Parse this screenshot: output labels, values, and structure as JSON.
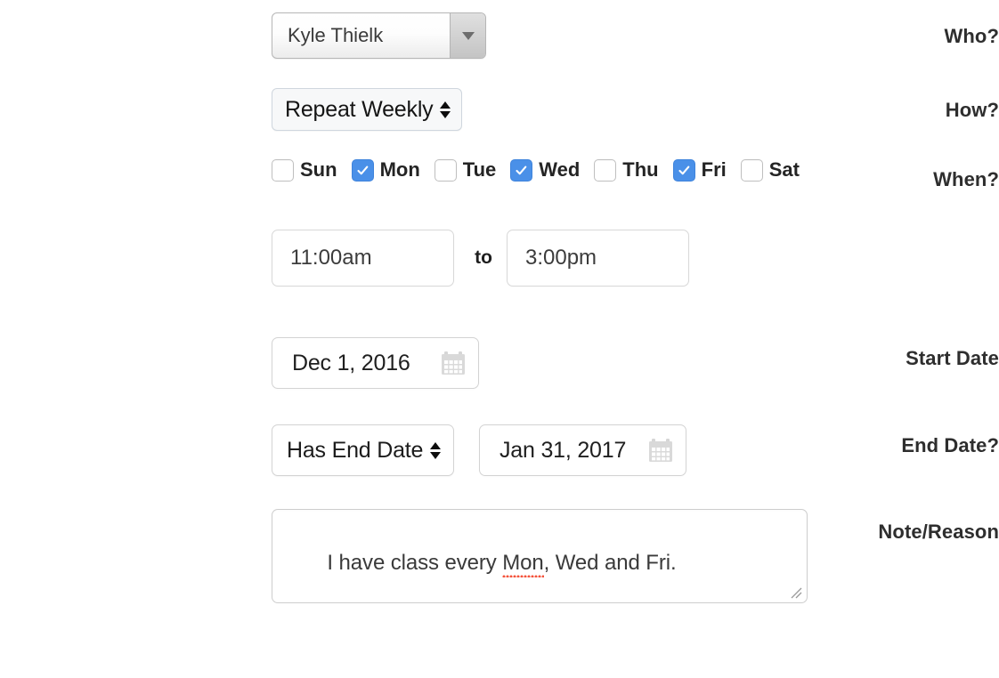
{
  "form": {
    "who": {
      "label": "Who?",
      "value": "Kyle Thielk",
      "icon": "chevron-down-icon"
    },
    "how": {
      "label": "How?",
      "value": "Repeat Weekly",
      "icon": "select-updown-icon"
    },
    "when": {
      "label": "When?",
      "days": [
        {
          "name": "Sun",
          "checked": false
        },
        {
          "name": "Mon",
          "checked": true
        },
        {
          "name": "Tue",
          "checked": false
        },
        {
          "name": "Wed",
          "checked": true
        },
        {
          "name": "Thu",
          "checked": false
        },
        {
          "name": "Fri",
          "checked": true
        },
        {
          "name": "Sat",
          "checked": false
        }
      ]
    },
    "time": {
      "from_value": "11:00am",
      "separator": "to",
      "to_value": "3:00pm"
    },
    "start_date": {
      "label": "Start Date",
      "value": "Dec 1, 2016",
      "icon": "calendar-icon"
    },
    "end_date": {
      "label": "End Date?",
      "type_value": "Has End Date",
      "value": "Jan 31, 2017",
      "icon": "calendar-icon"
    },
    "note": {
      "label": "Note/Reason",
      "text_before": "I have class every ",
      "misspelled_word": "Mon",
      "text_after": ", Wed and Fri."
    }
  },
  "colors": {
    "checkbox_checked": "#4a90e8",
    "label_text": "#2e2e2e",
    "field_text": "#3a3a3a",
    "field_border": "#d3d3d3",
    "spellcheck_underline": "#f4533c",
    "calendar_icon": "#d6d6d6"
  }
}
